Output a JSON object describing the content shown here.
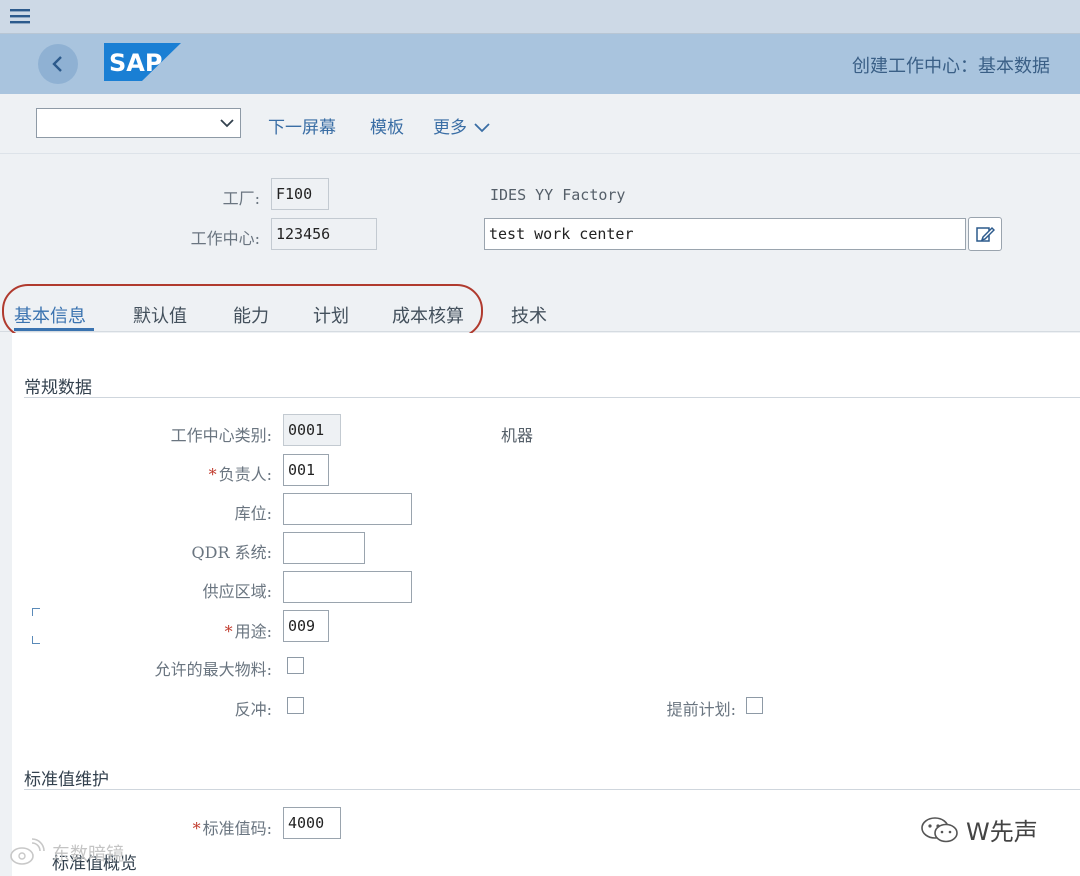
{
  "header": {
    "title": "创建工作中心：基本数据",
    "logo_text": "SAP"
  },
  "toolbar": {
    "select_value": "",
    "next_screen": "下一屏幕",
    "template": "模板",
    "more": "更多"
  },
  "head_fields": {
    "plant_label": "工厂:",
    "plant_value": "F100",
    "plant_desc": "IDES YY Factory",
    "workcenter_label": "工作中心:",
    "workcenter_value": "123456",
    "workcenter_desc": "test work center"
  },
  "tabs": [
    {
      "label": "基本信息",
      "active": true
    },
    {
      "label": "默认值",
      "active": false
    },
    {
      "label": "能力",
      "active": false
    },
    {
      "label": "计划",
      "active": false
    },
    {
      "label": "成本核算",
      "active": false
    },
    {
      "label": "技术",
      "active": false
    }
  ],
  "general": {
    "title": "常规数据",
    "category_label": "工作中心类别:",
    "category_value": "0001",
    "category_desc": "机器",
    "person_label": "负责人:",
    "person_value": "001",
    "storage_label": "库位:",
    "storage_value": "",
    "qdr_label": "QDR 系统:",
    "qdr_value": "",
    "supply_label": "供应区域:",
    "supply_value": "",
    "usage_label": "用途:",
    "usage_value": "009",
    "max_material_label": "允许的最大物料:",
    "backflush_label": "反冲:",
    "advance_plan_label": "提前计划:",
    "required_mark": "*"
  },
  "standard": {
    "title": "标准值维护",
    "key_label": "标准值码:",
    "key_value": "4000",
    "overview_label": "标准值概览"
  },
  "watermark": {
    "main": "W先声",
    "secondary": "东数暗镜"
  },
  "colors": {
    "accent": "#3a73b0",
    "highlight_oval": "#b03a2e",
    "header_bg": "#a9c4de",
    "sap_blue": "#1a7fd4"
  }
}
